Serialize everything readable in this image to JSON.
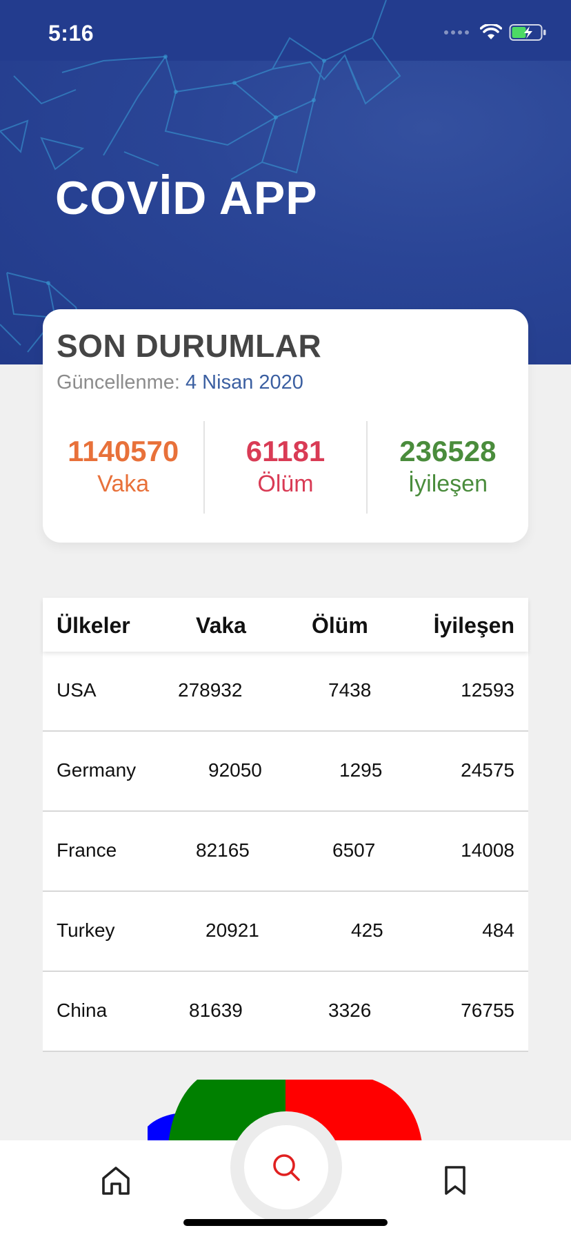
{
  "status_bar": {
    "time": "5:16"
  },
  "header": {
    "title": "COVİD APP"
  },
  "summary": {
    "title": "SON DURUMLAR",
    "updated_label": "Güncellenme:",
    "updated_value": "4 Nisan 2020",
    "stats": [
      {
        "value": "1140570",
        "label": "Vaka",
        "color": "#e8713a"
      },
      {
        "value": "61181",
        "label": "Ölüm",
        "color": "#d93b55"
      },
      {
        "value": "236528",
        "label": "İyileşen",
        "color": "#4a8c3c"
      }
    ]
  },
  "table": {
    "columns": [
      "Ülkeler",
      "Vaka",
      "Ölüm",
      "İyileşen"
    ],
    "rows": [
      {
        "country": "USA",
        "cases": "278932",
        "deaths": "7438",
        "recovered": "12593"
      },
      {
        "country": "Germany",
        "cases": "92050",
        "deaths": "1295",
        "recovered": "24575"
      },
      {
        "country": "France",
        "cases": "82165",
        "deaths": "6507",
        "recovered": "14008"
      },
      {
        "country": "Turkey",
        "cases": "20921",
        "deaths": "425",
        "recovered": "484"
      },
      {
        "country": "China",
        "cases": "81639",
        "deaths": "3326",
        "recovered": "76755"
      }
    ]
  },
  "pie": {
    "colors": [
      "#0000ff",
      "#008000",
      "#ff0000"
    ]
  },
  "nav": {
    "items": [
      "home-icon",
      "search-icon",
      "bookmark-icon"
    ],
    "active_color": "#e02020"
  }
}
